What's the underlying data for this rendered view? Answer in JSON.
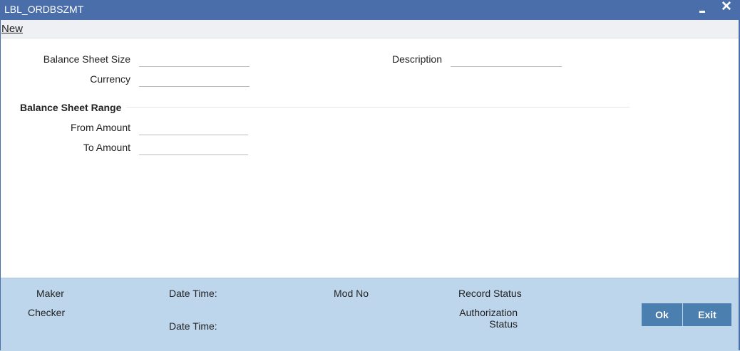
{
  "window": {
    "title": "LBL_ORDBSZMT"
  },
  "toolbar": {
    "new_label": "New"
  },
  "form": {
    "balance_sheet_size_label": "Balance Sheet Size",
    "balance_sheet_size_value": "",
    "currency_label": "Currency",
    "currency_value": "",
    "description_label": "Description",
    "description_value": "",
    "range_section_title": "Balance Sheet Range",
    "from_amount_label": "From Amount",
    "from_amount_value": "",
    "to_amount_label": "To Amount",
    "to_amount_value": ""
  },
  "footer": {
    "maker_label": "Maker",
    "checker_label": "Checker",
    "date_time_label": "Date Time:",
    "date_time_label_2": "Date Time:",
    "mod_no_label": "Mod No",
    "record_status_label": "Record Status",
    "authorization_status_line1": "Authorization",
    "authorization_status_line2": "Status",
    "ok_label": "Ok",
    "exit_label": "Exit"
  },
  "colors": {
    "titlebar": "#4a6ea9",
    "footer": "#bdd6ec",
    "button": "#4a7fb0"
  }
}
